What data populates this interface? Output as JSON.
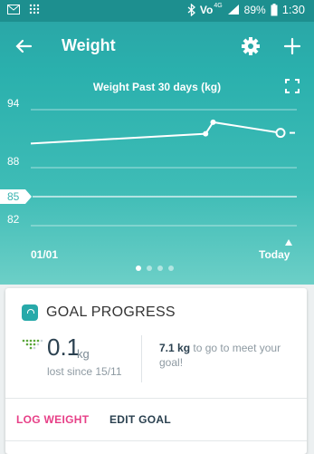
{
  "status_bar": {
    "battery_percent": "89%",
    "time": "1:30",
    "network_label": "4G"
  },
  "app_bar": {
    "title": "Weight",
    "back_icon": "arrow-left-icon",
    "settings_icon": "gear-icon",
    "add_icon": "plus-icon"
  },
  "chart": {
    "title": "Weight Past 30 days (kg)",
    "x_start_label": "01/01",
    "x_end_label": "Today",
    "goal_label": "85",
    "pager_dots": 4,
    "active_dot": 0
  },
  "chart_data": {
    "type": "line",
    "title": "Weight Past 30 days (kg)",
    "xlabel": "",
    "ylabel": "",
    "ylim": [
      82,
      94
    ],
    "y_ticks": [
      94,
      88,
      85,
      82
    ],
    "x_ticks": [
      "01/01",
      "Today"
    ],
    "goal_line": 85,
    "series": [
      {
        "x": [
          0.0,
          0.7,
          0.73,
          1.0
        ],
        "values": [
          90.5,
          91.5,
          92.7,
          91.6
        ]
      }
    ]
  },
  "goal_card": {
    "title": "GOAL PROGRESS",
    "lost_value": "0.1",
    "lost_unit": "kg",
    "lost_since": "lost since 15/11",
    "togo_amount": "7.1 kg",
    "togo_text": "to go to meet your goal!",
    "log_button": "LOG WEIGHT",
    "edit_button": "EDIT GOAL",
    "accent_color": "#e73f87",
    "teal_color": "#27a9a9"
  }
}
